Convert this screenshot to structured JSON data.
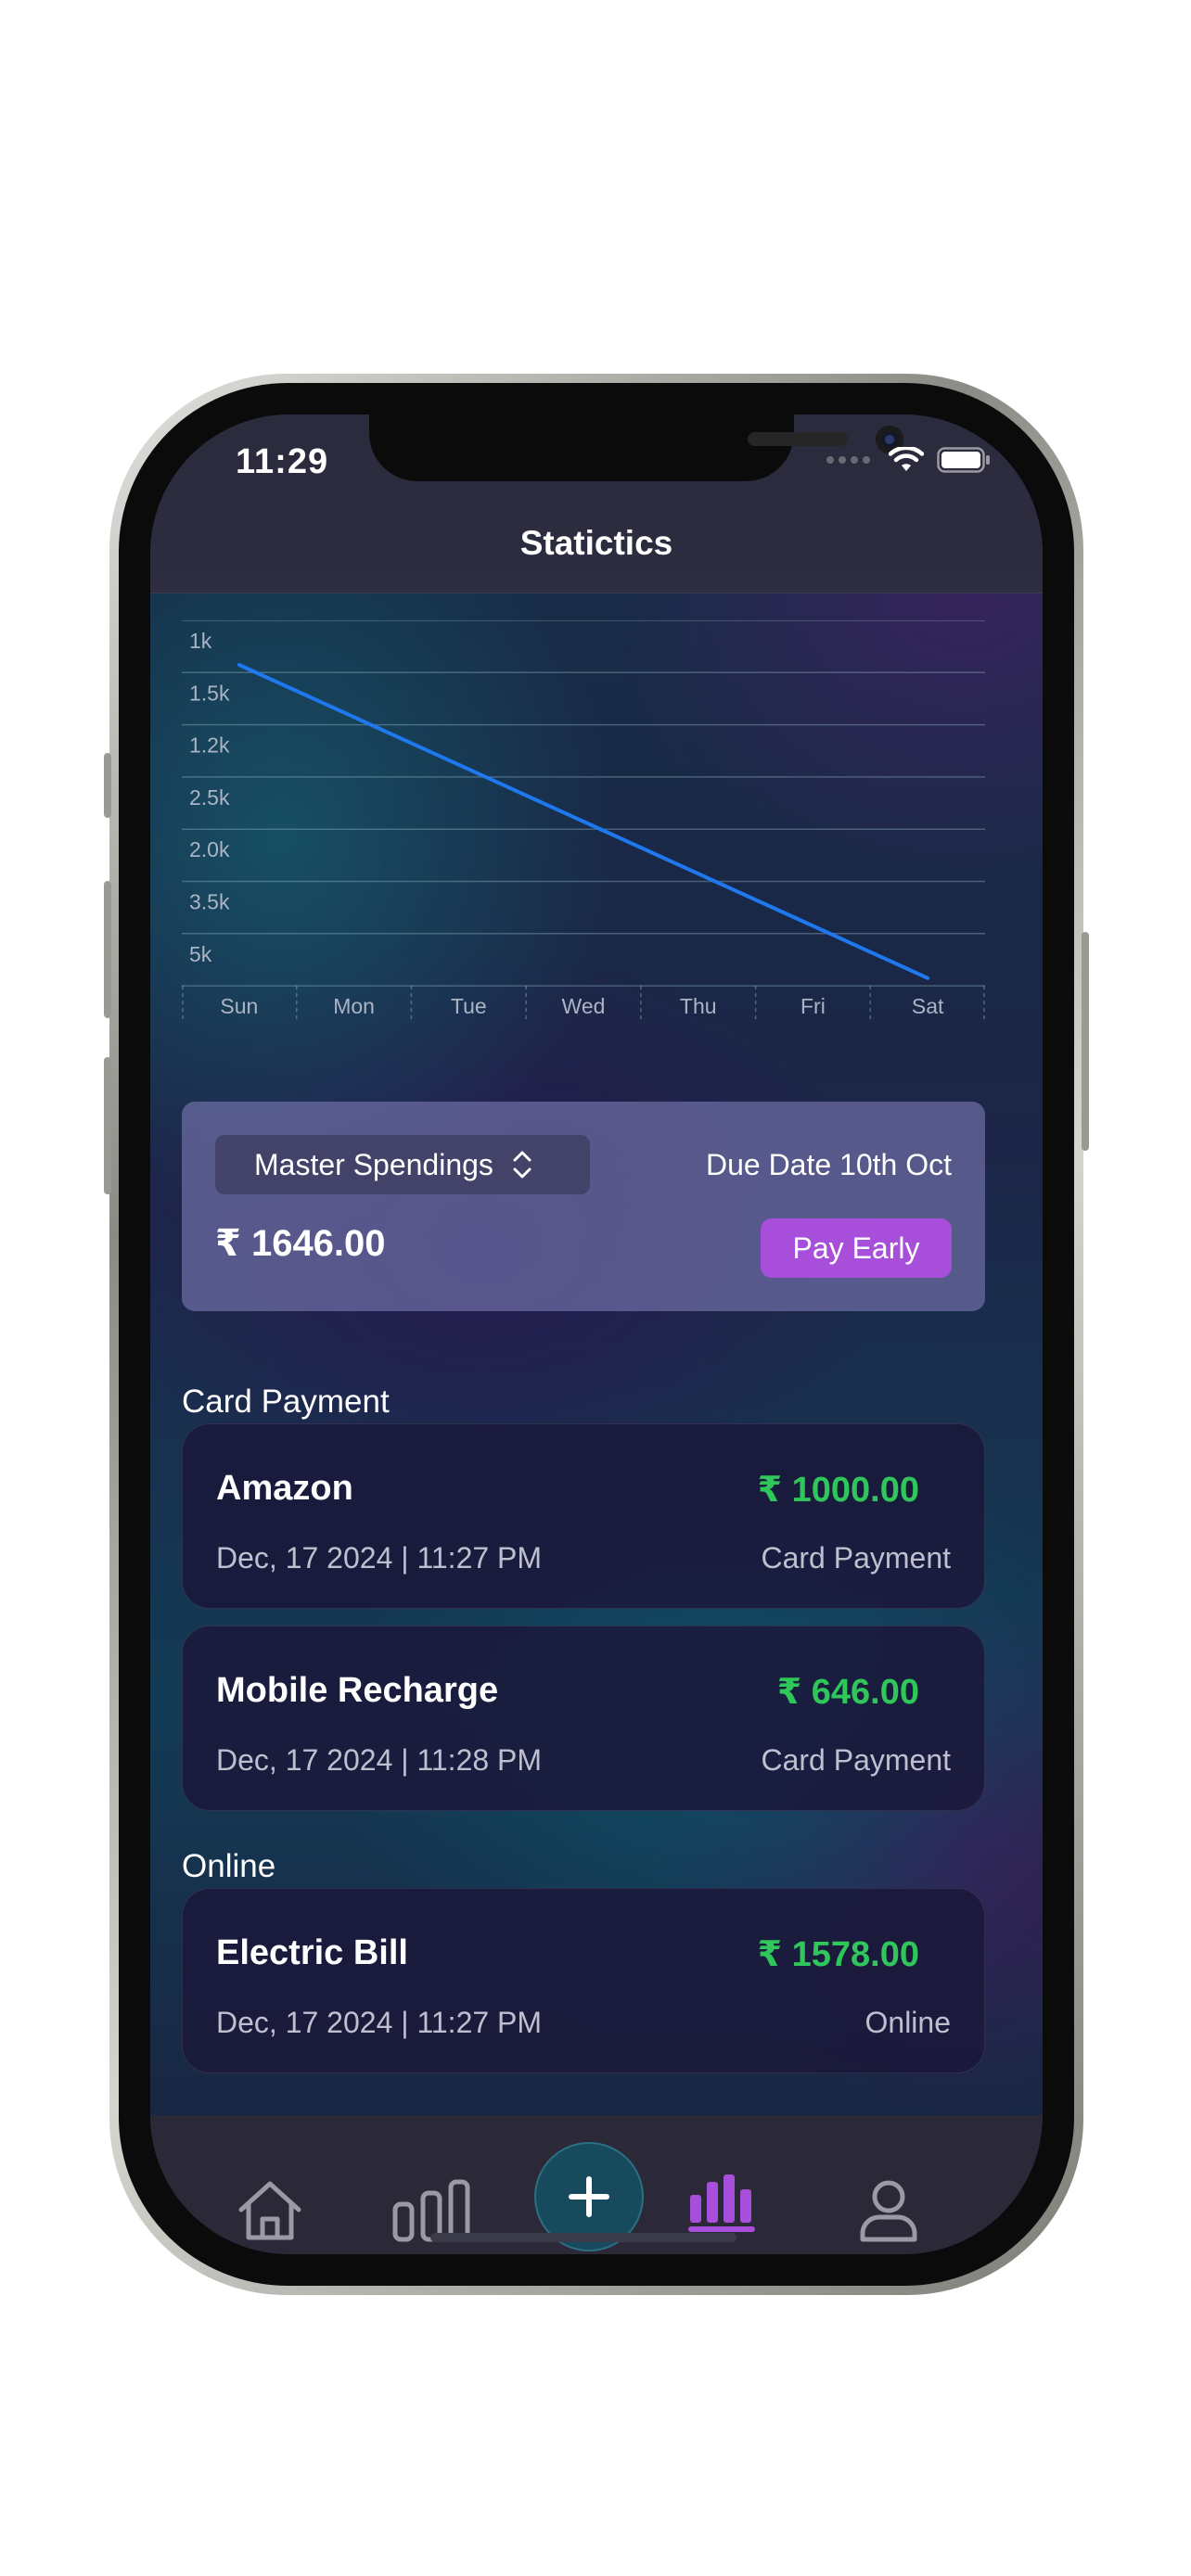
{
  "status_bar": {
    "time": "11:29"
  },
  "header": {
    "title": "Statictics"
  },
  "chart_data": {
    "type": "line",
    "categories": [
      "Sun",
      "Mon",
      "Tue",
      "Wed",
      "Thu",
      "Fri",
      "Sat"
    ],
    "y_tick_labels": [
      "1k",
      "1.5k",
      "1.2k",
      "2.5k",
      "2.0k",
      "3.5k",
      "5k"
    ],
    "series": [
      {
        "values": [
          1,
          2,
          3,
          4,
          5,
          6,
          7
        ],
        "color": "#1e78f0"
      }
    ],
    "grid": true
  },
  "spending_card": {
    "selector_label": "Master Spendings",
    "due_date": "Due Date 10th Oct",
    "amount": "₹ 1646.00",
    "pay_button": "Pay Early"
  },
  "sections": [
    {
      "label": "Card Payment",
      "transactions": [
        {
          "name": "Amazon",
          "amount": "₹ 1000.00",
          "date": "Dec, 17 2024 | 11:27 PM",
          "type": "Card Payment"
        },
        {
          "name": "Mobile Recharge",
          "amount": "₹ 646.00",
          "date": "Dec, 17 2024 | 11:28 PM",
          "type": "Card Payment"
        }
      ]
    },
    {
      "label": "Online",
      "transactions": [
        {
          "name": "Electric Bill",
          "amount": "₹ 1578.00",
          "date": "Dec, 17 2024 | 11:27 PM",
          "type": "Online"
        }
      ]
    }
  ],
  "tab_bar": {
    "items": [
      {
        "icon": "home-icon",
        "active": false
      },
      {
        "icon": "bar-chart-icon",
        "active": false
      },
      {
        "icon": "plus-icon",
        "active": false
      },
      {
        "icon": "statistics-icon",
        "active": true
      },
      {
        "icon": "profile-icon",
        "active": false
      }
    ],
    "active_color": "#a74fdb",
    "inactive_color": "#9a9aa5"
  }
}
